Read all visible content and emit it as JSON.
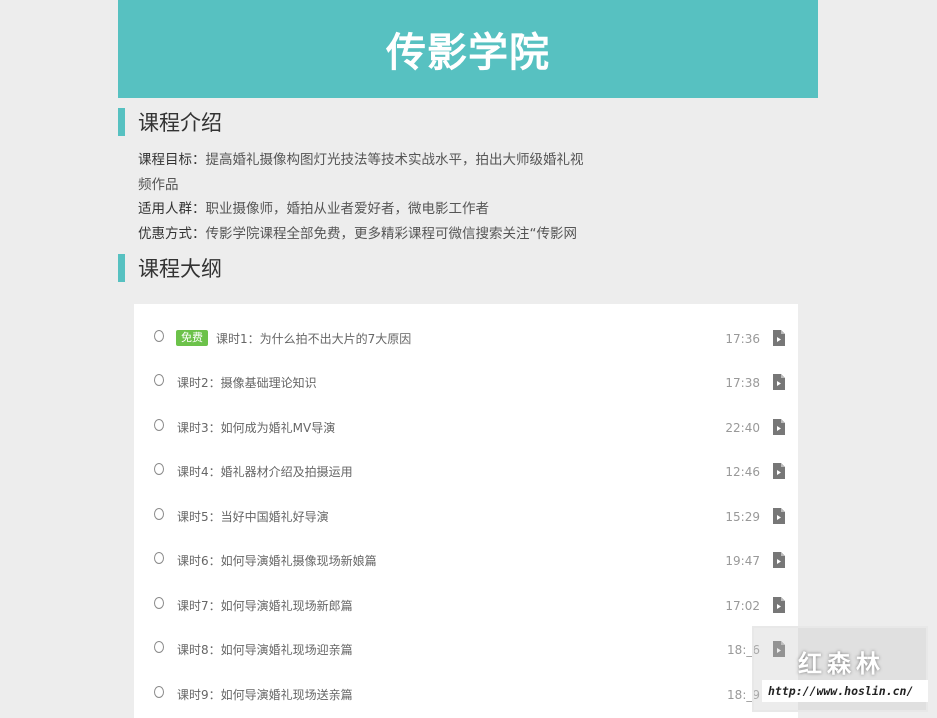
{
  "header": {
    "title": "传影学院"
  },
  "intro": {
    "heading": "课程介绍",
    "goal_label": "课程目标：",
    "goal_text": "提高婚礼摄像构图灯光技法等技术实战水平，拍出大师级婚礼视",
    "goal_text_2": "频作品",
    "audience_label": "适用人群：",
    "audience_text": "职业摄像师，婚拍从业者爱好者，微电影工作者",
    "offer_label": "优惠方式：",
    "offer_text": "传影学院课程全部免费，更多精彩课程可微信搜索关注“传影网"
  },
  "outline": {
    "heading": "课程大纲",
    "free_badge": "免费",
    "lessons": [
      {
        "title": "课时1：为什么拍不出大片的7大原因",
        "duration": "17:36"
      },
      {
        "title": "课时2：摄像基础理论知识",
        "duration": "17:38"
      },
      {
        "title": "课时3：如何成为婚礼MV导演",
        "duration": "22:40"
      },
      {
        "title": "课时4：婚礼器材介绍及拍摄运用",
        "duration": "12:46"
      },
      {
        "title": "课时5：当好中国婚礼好导演",
        "duration": "15:29"
      },
      {
        "title": "课时6：如何导演婚礼摄像现场新娘篇",
        "duration": "19:47"
      },
      {
        "title": "课时7：如何导演婚礼现场新郎篇",
        "duration": "17:02"
      },
      {
        "title": "课时8：如何导演婚礼现场迎亲篇",
        "duration": "18:_6"
      },
      {
        "title": "课时9：如何导演婚礼现场送亲篇",
        "duration": "18:_9"
      }
    ]
  },
  "watermark": {
    "name": "红森林",
    "url": "http://www.hoslin.cn/"
  },
  "colors": {
    "accent": "#57c1c1",
    "badge": "#6cc24a",
    "background": "#ededed"
  }
}
